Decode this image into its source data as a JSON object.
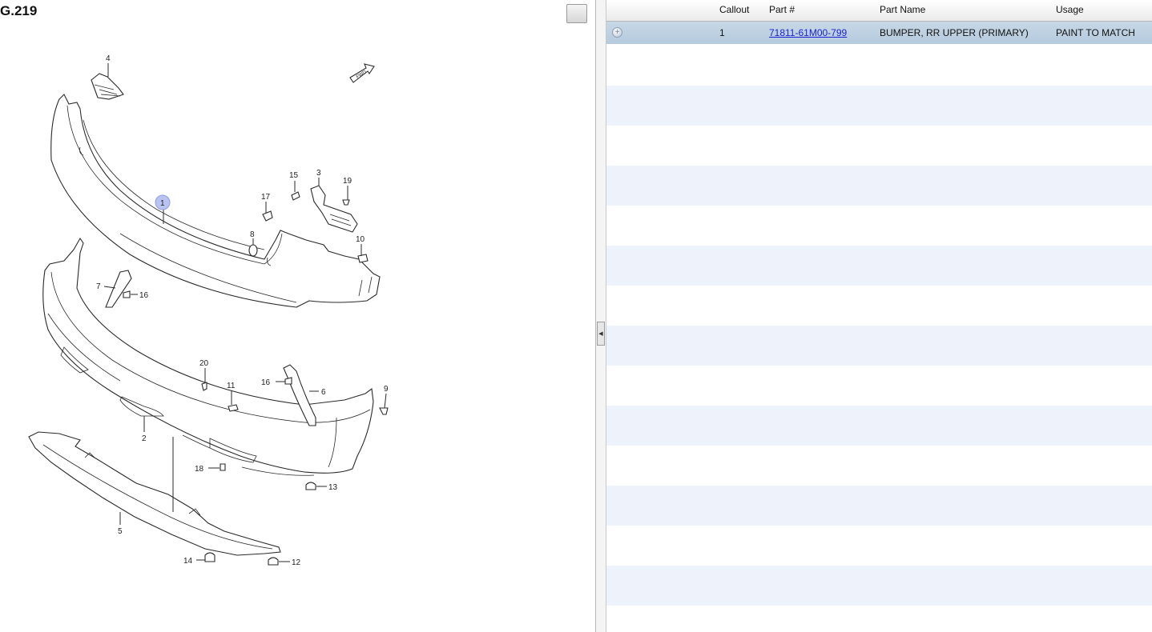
{
  "figure": {
    "title": "G.219",
    "callouts": [
      {
        "num": "1",
        "highlighted": true
      },
      {
        "num": "2"
      },
      {
        "num": "3"
      },
      {
        "num": "4"
      },
      {
        "num": "5"
      },
      {
        "num": "6"
      },
      {
        "num": "7"
      },
      {
        "num": "8"
      },
      {
        "num": "9"
      },
      {
        "num": "10"
      },
      {
        "num": "11"
      },
      {
        "num": "12"
      },
      {
        "num": "13"
      },
      {
        "num": "14"
      },
      {
        "num": "15"
      },
      {
        "num": "16"
      },
      {
        "num": "16"
      },
      {
        "num": "17"
      },
      {
        "num": "18"
      },
      {
        "num": "19"
      },
      {
        "num": "20"
      }
    ],
    "fwd_mark": "FWD"
  },
  "parts_table": {
    "columns": [
      "Callout",
      "Part #",
      "Part Name",
      "Usage"
    ],
    "rows": [
      {
        "callout": "1",
        "part_number": "71811-61M00-799",
        "part_name": "BUMPER, RR UPPER (PRIMARY)",
        "usage": "PAINT TO MATCH",
        "selected": true
      }
    ]
  },
  "colors": {
    "selected_row": "#bdd0e2",
    "alt_row": "#eef3fb",
    "link": "#1b22d6",
    "callout_highlight": "#b9c3f2"
  },
  "icons": {
    "row_expand": "expand-circle-icon",
    "splitter_toggle": "collapse-left-arrow-icon",
    "fwd_arrow": "forward-arrow-icon"
  }
}
